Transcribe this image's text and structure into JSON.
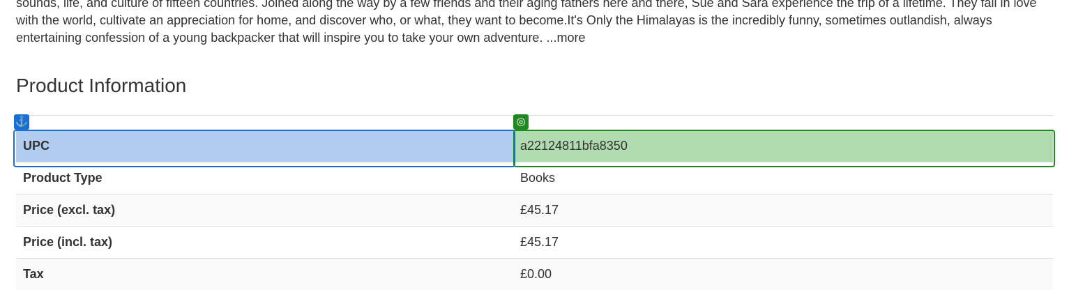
{
  "description": {
    "text": "sounds, life, and culture of fifteen countries. Joined along the way by a few friends and their aging fathers here and there, Sue and Sara experience the trip of a lifetime. They fall in love with the world, cultivate an appreciation for home, and discover who, or what, they want to become.It's Only the Himalayas is the incredibly funny, sometimes outlandish, always entertaining confession of a young backpacker that will inspire you to take your own adventure.",
    "more_link": "...more"
  },
  "product_info": {
    "title": "Product Information",
    "rows": [
      {
        "label": "UPC",
        "value": "a22124811bfa8350"
      },
      {
        "label": "Product Type",
        "value": "Books"
      },
      {
        "label": "Price (excl. tax)",
        "value": "£45.17"
      },
      {
        "label": "Price (incl. tax)",
        "value": "£45.17"
      },
      {
        "label": "Tax",
        "value": "£0.00"
      }
    ]
  },
  "markers": {
    "anchor_icon": "anchor-icon",
    "target_icon": "target-icon",
    "anchor_color": "#1a6fd4",
    "target_color": "#1f8a1f"
  }
}
